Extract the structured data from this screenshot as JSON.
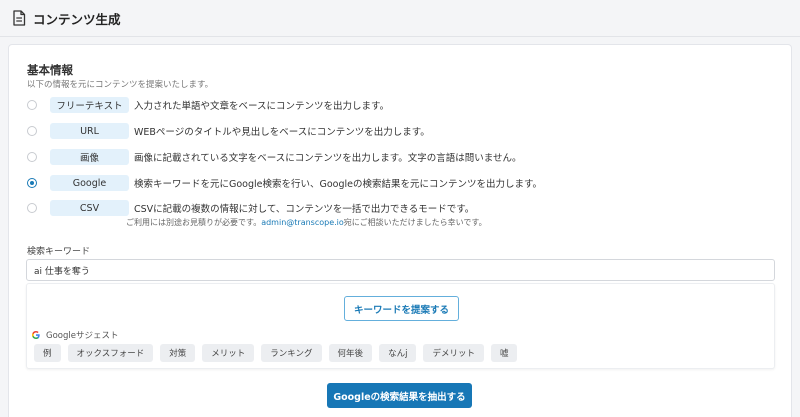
{
  "header": {
    "title": "コンテンツ生成"
  },
  "section": {
    "title": "基本情報",
    "subtitle": "以下の情報を元にコンテンツを提案いたします。"
  },
  "options": [
    {
      "label": "フリーテキスト",
      "desc": "入力された単語や文章をベースにコンテンツを出力します。",
      "checked": false
    },
    {
      "label": "URL",
      "desc": "WEBページのタイトルや見出しをベースにコンテンツを出力します。",
      "checked": false
    },
    {
      "label": "画像",
      "desc": "画像に記載されている文字をベースにコンテンツを出力します。文字の言語は問いません。",
      "checked": false
    },
    {
      "label": "Google",
      "desc": "検索キーワードを元にGoogle検索を行い、Googleの検索結果を元にコンテンツを出力します。",
      "checked": true
    },
    {
      "label": "CSV",
      "desc": "CSVに記載の複数の情報に対して、コンテンツを一括で出力できるモードです。",
      "checked": false
    }
  ],
  "csv_note": {
    "prefix": "ご利用には別途お見積りが必要です。",
    "email": "admin@transcope.io",
    "suffix": "宛にご相談いただけましたら幸いです。"
  },
  "keyword": {
    "label": "検索キーワード",
    "value": "ai 仕事を奪う"
  },
  "suggest": {
    "button_label": "キーワードを提案する",
    "google_label": "Googleサジェスト",
    "chips": [
      "例",
      "オックスフォード",
      "対策",
      "メリット",
      "ランキング",
      "何年後",
      "なんj",
      "デメリット",
      "嘘"
    ]
  },
  "extract_button": "Googleの検索結果を抽出する",
  "colors": {
    "accent": "#1777b6",
    "label_bg": "#e3f1fb"
  }
}
